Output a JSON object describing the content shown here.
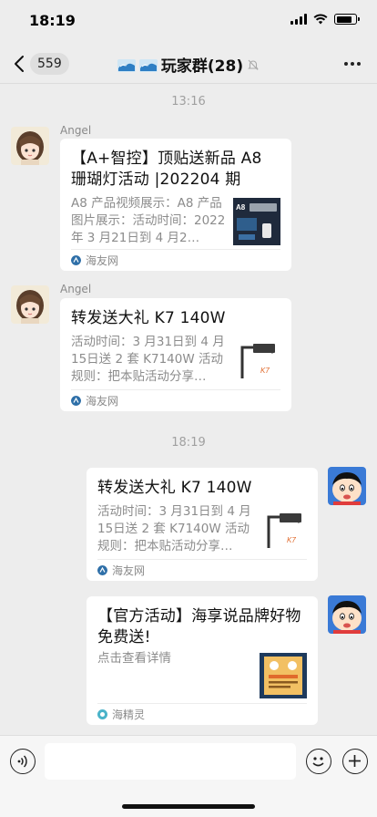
{
  "status_bar": {
    "time": "18:19"
  },
  "nav": {
    "unread_count": "559",
    "title": "玩家群(28)"
  },
  "timestamps": [
    "13:16",
    "18:19"
  ],
  "messages": [
    {
      "sender": "Angel",
      "title": "【A+智控】顶贴送新品 A8 珊瑚灯活动 |202204 期",
      "desc": "A8 产品视频展示：A8 产品图片展示：活动时间：2022 年 3 月21日到 4 月2…",
      "thumb_text": "A8",
      "source": "海友网"
    },
    {
      "sender": "Angel",
      "title": "转发送大礼 K7 140W",
      "desc": "活动时间：3 月31日到 4 月15日送 2 套 K7140W 活动规则：把本贴活动分享…",
      "source": "海友网"
    },
    {
      "title": "转发送大礼 K7 140W",
      "desc": "活动时间：3 月31日到 4 月15日送 2 套 K7140W 活动规则：把本贴活动分享…",
      "source": "海友网"
    },
    {
      "title": "【官方活动】海享说品牌好物免费送!",
      "desc": "点击查看详情",
      "source": "海精灵"
    }
  ],
  "colors": {
    "background": "#ededed",
    "card": "#ffffff",
    "muted_text": "#8c8c8c"
  },
  "icons": [
    "back-icon",
    "mute-icon",
    "more-icon",
    "voice-icon",
    "emoji-icon",
    "plus-icon",
    "source-icon"
  ]
}
